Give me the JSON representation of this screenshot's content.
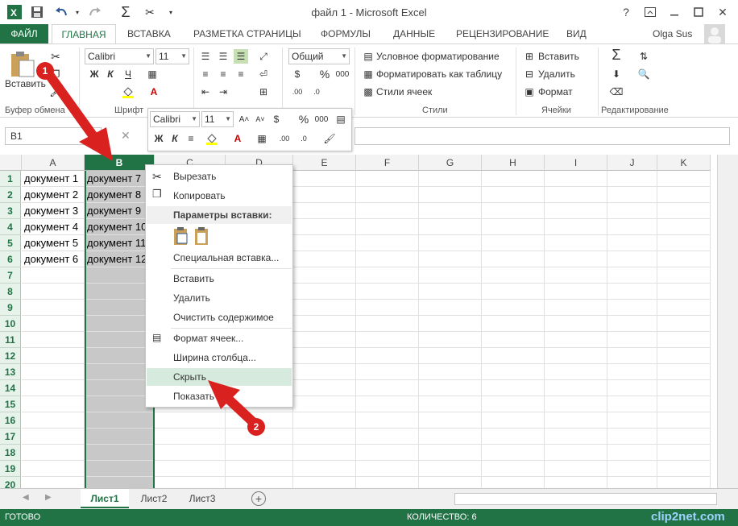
{
  "titlebar": {
    "title": "файл 1 - Microsoft Excel",
    "help": "?",
    "user": "Olga Sus"
  },
  "tabs": {
    "file": "ФАЙЛ",
    "home": "ГЛАВНАЯ",
    "insert": "ВСТАВКА",
    "layout": "РАЗМЕТКА СТРАНИЦЫ",
    "formulas": "ФОРМУЛЫ",
    "data": "ДАННЫЕ",
    "review": "РЕЦЕНЗИРОВАНИЕ",
    "view": "ВИД"
  },
  "ribbon": {
    "paste_label": "Вставить",
    "font_name": "Calibri",
    "font_size": "11",
    "bold": "Ж",
    "italic": "К",
    "underline": "Ч",
    "number_format": "Общий",
    "cond_format": "Условное форматирование",
    "format_table": "Форматировать как таблицу",
    "cell_styles": "Стили ячеек",
    "insert": "Вставить",
    "delete": "Удалить",
    "format": "Формат",
    "groups": {
      "clipboard": "Буфер обмена",
      "font": "Шрифт",
      "styles": "Стили",
      "cells": "Ячейки",
      "editing": "Редактирование"
    }
  },
  "formula_bar": {
    "name_box": "B1",
    "cancel": "✕"
  },
  "mini_toolbar": {
    "font_name": "Calibri",
    "font_size": "11",
    "percent": "%",
    "thousands": "000",
    "bold": "Ж",
    "italic": "К"
  },
  "grid": {
    "columns": [
      "A",
      "B",
      "C",
      "D",
      "E",
      "F",
      "G",
      "H",
      "I",
      "J",
      "K"
    ],
    "rows": [
      "1",
      "2",
      "3",
      "4",
      "5",
      "6",
      "7",
      "8",
      "9",
      "10",
      "11",
      "12",
      "13",
      "14",
      "15",
      "16",
      "17",
      "18",
      "19",
      "20"
    ],
    "col_a": [
      "документ 1",
      "документ 2",
      "документ 3",
      "документ 4",
      "документ 5",
      "документ 6"
    ],
    "col_b": [
      "документ 7",
      "документ 8",
      "документ 9",
      "документ 10",
      "документ 11",
      "документ 12"
    ]
  },
  "context_menu": {
    "cut": "Вырезать",
    "copy": "Копировать",
    "paste_options": "Параметры вставки:",
    "paste_special": "Специальная вставка...",
    "insert": "Вставить",
    "delete": "Удалить",
    "clear": "Очистить содержимое",
    "format_cells": "Формат ячеек...",
    "col_width": "Ширина столбца...",
    "hide": "Скрыть",
    "show": "Показать"
  },
  "annotations": {
    "step1": "1",
    "step2": "2",
    "arrow_color": "#d9221f"
  },
  "sheets": [
    "Лист1",
    "Лист2",
    "Лист3"
  ],
  "status": {
    "ready": "ГОТОВО",
    "count": "КОЛИЧЕСТВО: 6",
    "watermark": "clip2net.com"
  },
  "colors": {
    "accent": "#217346",
    "selected_column": "#c8c8c8",
    "hover": "#d6ebdd"
  }
}
